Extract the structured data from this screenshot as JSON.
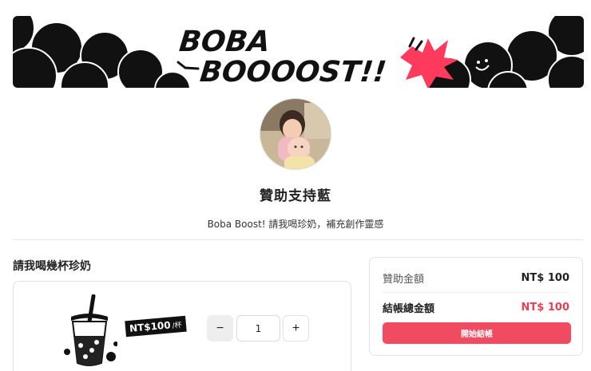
{
  "banner": {
    "line1": "BOBA",
    "line2": "BOOOOST!!"
  },
  "profile": {
    "name": "贊助支持藍",
    "subtitle": "Boba Boost! 請我喝珍奶，補充創作靈感"
  },
  "section": {
    "heading": "請我喝幾杯珍奶"
  },
  "product": {
    "price": "NT$100",
    "unit": "/杯",
    "quantity": "1",
    "minus": "−",
    "plus": "+"
  },
  "summary": {
    "amount_label": "贊助金額",
    "amount_value": "NT$ 100",
    "total_label": "結帳總金額",
    "total_value": "NT$ 100",
    "checkout_label": "開始結帳"
  },
  "colors": {
    "accent": "#f04b61",
    "accent_text": "#ec3e55",
    "banner_pink": "#ff3a5c",
    "ink": "#111111"
  }
}
